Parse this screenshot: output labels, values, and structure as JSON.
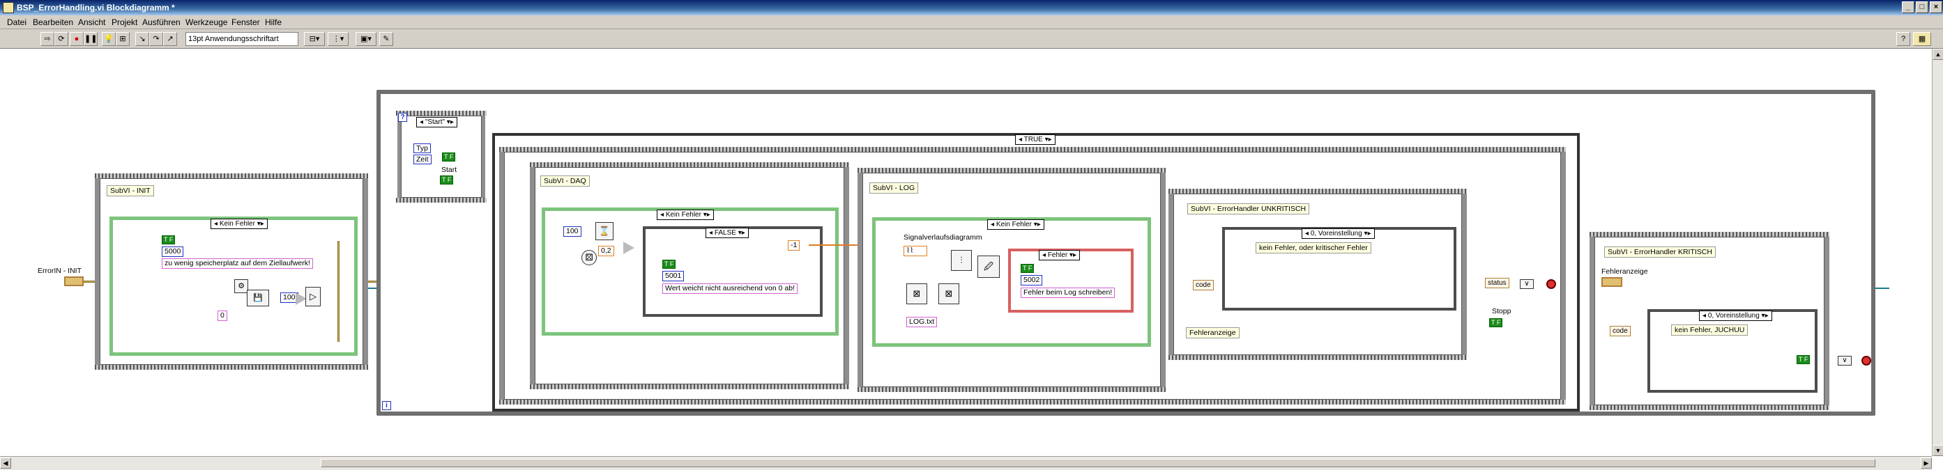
{
  "window": {
    "title": "BSP_ErrorHandling.vi Blockdiagramm *",
    "buttons": [
      "_",
      "□",
      "×"
    ]
  },
  "menu": [
    "Datei",
    "Bearbeiten",
    "Ansicht",
    "Projekt",
    "Ausführen",
    "Werkzeuge",
    "Fenster",
    "Hilfe"
  ],
  "toolbar": {
    "font_select": "13pt Anwendungsschriftart",
    "help": "?"
  },
  "diagram": {
    "left_control": "ErrorIN - INIT",
    "init_frame": {
      "label": "SubVI - INIT",
      "case_selector": "Kein Fehler",
      "bool": "T F",
      "error_code": "5000",
      "message": "zu wenig speicherplatz auf dem Ziellaufwerk!",
      "num_const": "100",
      "small_num": "0"
    },
    "loop_select": {
      "case_selector": "\"Start\"",
      "items": [
        "Typ",
        "Zeit"
      ],
      "start_label": "Start",
      "bool": "T F"
    },
    "main_case_selector": "TRUE",
    "daq": {
      "label": "SubVI - DAQ",
      "case_selector": "Kein Fehler",
      "num_const": "100",
      "dbl_const": "0,2",
      "inner_case": "FALSE",
      "bool": "T F",
      "error_code": "5001",
      "message": "Wert weicht nicht ausreichend von 0 ab!",
      "neg_const": "-1"
    },
    "log": {
      "label": "SubVI - LOG",
      "case_selector": "Kein Fehler",
      "graph_label": "Signalverlaufsdiagramm",
      "file": "LOG.txt",
      "error_case": "Fehler",
      "bool": "T F",
      "error_code": "5002",
      "message": "Fehler beim Log schreiben!"
    },
    "unkritisch": {
      "label": "SubVI - ErrorHandler UNKRITISCH",
      "case_selector": "0, Voreinstellung",
      "message": "kein Fehler, oder kritischer Fehler",
      "code": "code",
      "indicator": "Fehleranzeige"
    },
    "status": "status",
    "stopp_label": "Stopp",
    "stopp_bool": "T F",
    "kritisch": {
      "label": "SubVI - ErrorHandler KRITISCH",
      "indicator": "Fehleranzeige",
      "code": "code",
      "case_selector": "0, Voreinstellung",
      "message": "kein Fehler, JUCHUU",
      "bool": "T F"
    },
    "iteration": "i"
  },
  "colors": {
    "error_wire": "#c8b060",
    "ref_wire": "#1a7a8a",
    "bool": "#1c8c1c",
    "string": "#d060d0",
    "numeric": "#2030c0",
    "double": "#e07a20"
  }
}
